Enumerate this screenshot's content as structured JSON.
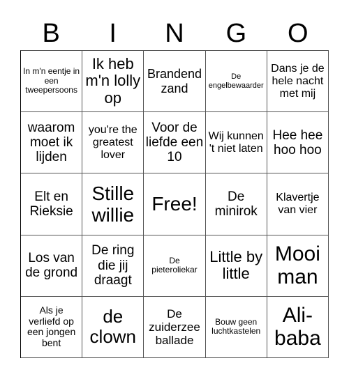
{
  "header": {
    "letters": [
      "B",
      "I",
      "N",
      "G",
      "O"
    ]
  },
  "cells": [
    [
      "In m'n eentje in een tweepersoons",
      "Ik heb m'n lolly op",
      "Brandend zand",
      "De engelbewaarder",
      "Dans je de hele nacht met mij"
    ],
    [
      "waarom moet ik lijden",
      "you're the greatest lover",
      "Voor de liefde een 10",
      "Wij kunnen 't niet laten",
      "Hee hee hoo hoo"
    ],
    [
      "Elt en Rieksie",
      "Stille willie",
      "Free!",
      "De minirok",
      "Klavertje van vier"
    ],
    [
      "Los van de grond",
      "De ring die jij draagt",
      "De pieteroliekar",
      "Little by little",
      "Mooi man"
    ],
    [
      "Als je verliefd op een jongen bent",
      "de clown",
      "De zuiderzee ballade",
      "Bouw geen luchtkastelen",
      "Ali-baba"
    ]
  ]
}
